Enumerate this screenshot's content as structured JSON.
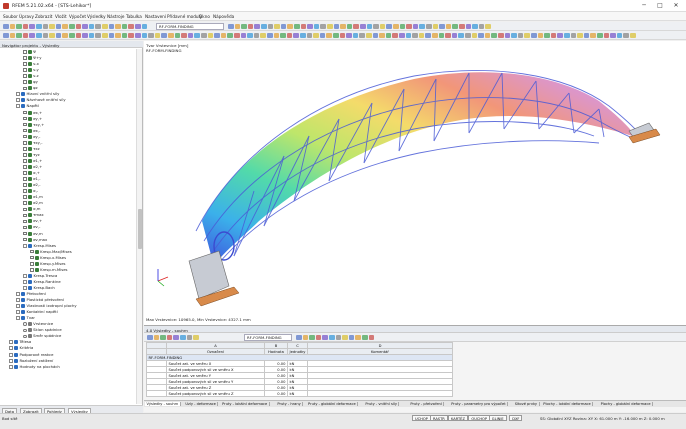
{
  "window": {
    "title": "RFEM 5.21.02.x64 - [STS-Lehikor*]",
    "min": "─",
    "max": "□",
    "close": "✕"
  },
  "menu": [
    "Soubor",
    "Úpravy",
    "Zobrazit",
    "Vložit",
    "Výpočet",
    "Výsledky",
    "Nástroje",
    "Tabulka",
    "Nastavení",
    "Přídavné moduly",
    "Okno",
    "Nápověda"
  ],
  "toolbar": {
    "combo1": "RF-FORM-FINDING",
    "combo2": ""
  },
  "navigator": {
    "title": "Navigátor projektu - Výsledky",
    "items": [
      {
        "label": "Ψ",
        "level": 3,
        "kind": "cb"
      },
      {
        "label": "Ψ+y",
        "level": 3,
        "kind": "cb"
      },
      {
        "label": "v-x",
        "level": 3,
        "kind": "cb"
      },
      {
        "label": "v-y",
        "level": 3,
        "kind": "cb"
      },
      {
        "label": "v-z",
        "level": 3,
        "kind": "cb"
      },
      {
        "label": "φy",
        "level": 3,
        "kind": "cb"
      },
      {
        "label": "φz",
        "level": 3,
        "kind": "cb"
      },
      {
        "label": "Hlavní vnitřní síly",
        "level": 2,
        "kind": "ex"
      },
      {
        "label": "Návrhové vnitřní síly",
        "level": 2,
        "kind": "ex"
      },
      {
        "label": "Napětí",
        "level": 2,
        "kind": "ex"
      },
      {
        "label": "σx,+",
        "level": 3,
        "kind": "cb"
      },
      {
        "label": "σy,+",
        "level": 3,
        "kind": "cb"
      },
      {
        "label": "τxy,+",
        "level": 3,
        "kind": "cb"
      },
      {
        "label": "σx,-",
        "level": 3,
        "kind": "cb"
      },
      {
        "label": "σy,-",
        "level": 3,
        "kind": "cb"
      },
      {
        "label": "τxy,-",
        "level": 3,
        "kind": "cb"
      },
      {
        "label": "τxz",
        "level": 3,
        "kind": "cb"
      },
      {
        "label": "τyz",
        "level": 3,
        "kind": "cb"
      },
      {
        "label": "σ1,+",
        "level": 3,
        "kind": "cb"
      },
      {
        "label": "σ2,+",
        "level": 3,
        "kind": "cb"
      },
      {
        "label": "α,+",
        "level": 3,
        "kind": "cb"
      },
      {
        "label": "σ1,-",
        "level": 3,
        "kind": "cb"
      },
      {
        "label": "σ2,-",
        "level": 3,
        "kind": "cb"
      },
      {
        "label": "α,-",
        "level": 3,
        "kind": "cb"
      },
      {
        "label": "σ1,m",
        "level": 3,
        "kind": "cb"
      },
      {
        "label": "σ2,m",
        "level": 3,
        "kind": "cb"
      },
      {
        "label": "α,m",
        "level": 3,
        "kind": "cb"
      },
      {
        "label": "τmax",
        "level": 3,
        "kind": "cb"
      },
      {
        "label": "σv,+",
        "level": 3,
        "kind": "cb"
      },
      {
        "label": "σv,-",
        "level": 3,
        "kind": "cb"
      },
      {
        "label": "σv,m",
        "level": 3,
        "kind": "cb"
      },
      {
        "label": "σv,max",
        "level": 3,
        "kind": "cb"
      },
      {
        "label": "Kresp.Mises",
        "level": 3,
        "kind": "ex"
      },
      {
        "label": "Kresp.Max/Mises",
        "level": 4,
        "kind": "cb"
      },
      {
        "label": "Kresp.x.Mises",
        "level": 4,
        "kind": "cb"
      },
      {
        "label": "Kresp.y.Mises",
        "level": 4,
        "kind": "cb"
      },
      {
        "label": "Kresp.m.Mises",
        "level": 4,
        "kind": "cb"
      },
      {
        "label": "Kresp.Tresca",
        "level": 3,
        "kind": "ex"
      },
      {
        "label": "Kresp.Rankine",
        "level": 3,
        "kind": "ex"
      },
      {
        "label": "Kresp.Bach",
        "level": 3,
        "kind": "ex"
      },
      {
        "label": "Přetvoření",
        "level": 2,
        "kind": "ex"
      },
      {
        "label": "Plastická přetvoření",
        "level": 2,
        "kind": "ex"
      },
      {
        "label": "Vlastnosti izotropní plochy",
        "level": 2,
        "kind": "ex"
      },
      {
        "label": "Kontaktní napětí",
        "level": 2,
        "kind": "ex"
      },
      {
        "label": "Tvar",
        "level": 2,
        "kind": "ex"
      },
      {
        "label": "Vrstevnice",
        "level": 3,
        "kind": "rd"
      },
      {
        "label": "Sklon spádnice",
        "level": 3,
        "kind": "rd"
      },
      {
        "label": "Směr spádnice",
        "level": 3,
        "kind": "rd"
      },
      {
        "label": "Tělesa",
        "level": 1,
        "kind": "ex"
      },
      {
        "label": "Kritéria",
        "level": 1,
        "kind": "ex"
      },
      {
        "label": "Podporové reakce",
        "level": 1,
        "kind": "ex"
      },
      {
        "label": "Rozložení zatížení",
        "level": 1,
        "kind": "ex"
      },
      {
        "label": "Hodnoty na plochách",
        "level": 1,
        "kind": "ex"
      }
    ],
    "tabs": [
      "Data",
      "Zobrazit",
      "Pohledy",
      "Výsledky"
    ]
  },
  "view": {
    "line1": "Tvar Vrstevnice [mm]",
    "line2": "RF-FORM-FINDING",
    "footer": "Max Vrstevnice: 10965.0, Min Vrstevnice: 4327.1 mm"
  },
  "results": {
    "title": "4.0 Výsledky - souhrn",
    "combo": "RF-FORM-FINDING",
    "headers": [
      "",
      "A",
      "B",
      "C",
      "D"
    ],
    "subheaders": [
      "",
      "Označení",
      "Hodnota",
      "Jednotky",
      "Komentář"
    ],
    "group": "RF-FORM-FINDING",
    "rows": [
      [
        "",
        "Součet zat. ve směru X",
        "0.00",
        "kN",
        ""
      ],
      [
        "",
        "Součet podporových sil ve směru X",
        "0.00",
        "kN",
        ""
      ],
      [
        "",
        "Součet zat. ve směru Y",
        "0.00",
        "kN",
        ""
      ],
      [
        "",
        "Součet podporových sil ve směru Y",
        "0.00",
        "kN",
        ""
      ],
      [
        "",
        "Součet zat. ve směru Z",
        "0.00",
        "kN",
        ""
      ],
      [
        "",
        "Součet podporových sil ve směru Z",
        "0.00",
        "kN",
        ""
      ]
    ],
    "tabs": [
      "Výsledky - souhrn",
      "Uzly - deformace",
      "Pruty - lokální deformace",
      "Pruty - hrany",
      "Pruty - globální deformace",
      "Pruty - vnitřní síly",
      "Pruty - přetvoření",
      "Pruty - parametry pro výpočet",
      "Sítové prvky",
      "Plochy - lokální deformace",
      "Plochy - globální deformace"
    ]
  },
  "status": {
    "left": "Bod sítě",
    "buttons": [
      "UCHOP",
      "RASTR",
      "KARTÉZ",
      "OUCHOP",
      "GLINIE",
      "DXF"
    ],
    "right": "SS: Globální XYZ  Rovina: XY    X: 61.000 m   Y: -16.000 m   Z: 0.000 m"
  }
}
